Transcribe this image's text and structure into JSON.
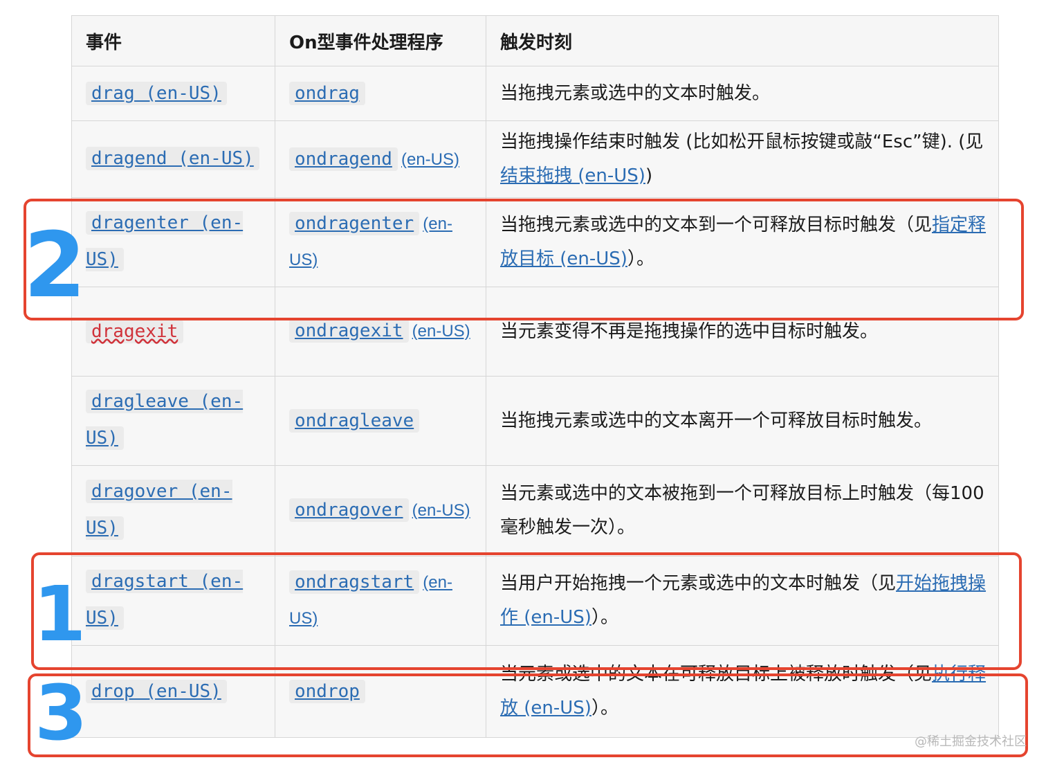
{
  "headers": {
    "event": "事件",
    "handler": "On型事件处理程序",
    "time": "触发时刻"
  },
  "rows": [
    {
      "event": "drag (en-US)",
      "handler": "ondrag",
      "handler_note": "",
      "desc": "当拖拽元素或选中的文本时触发。",
      "desc_link": "",
      "desc_suffix": ""
    },
    {
      "event": "dragend (en-US)",
      "handler": "ondragend",
      "handler_note": "(en-US)",
      "desc": "当拖拽操作结束时触发 (比如松开鼠标按键或敲“Esc”键). (见",
      "desc_link": "结束拖拽 (en-US)",
      "desc_suffix": ")"
    },
    {
      "event": "dragenter (en-US)",
      "handler": "ondragenter",
      "handler_note": "(en-US)",
      "desc": "当拖拽元素或选中的文本到一个可释放目标时触发（见",
      "desc_link": "指定释放目标 (en-US)",
      "desc_suffix": "）。"
    },
    {
      "event": "dragexit",
      "handler": "ondragexit",
      "handler_note": "(en-US)",
      "desc": "当元素变得不再是拖拽操作的选中目标时触发。",
      "desc_link": "",
      "desc_suffix": ""
    },
    {
      "event": "dragleave (en-US)",
      "handler": "ondragleave",
      "handler_note": "",
      "desc": "当拖拽元素或选中的文本离开一个可释放目标时触发。",
      "desc_link": "",
      "desc_suffix": ""
    },
    {
      "event": "dragover (en-US)",
      "handler": "ondragover",
      "handler_note": "(en-US)",
      "desc": "当元素或选中的文本被拖到一个可释放目标上时触发（每100毫秒触发一次）。",
      "desc_link": "",
      "desc_suffix": ""
    },
    {
      "event": "dragstart (en-US)",
      "handler": "ondragstart",
      "handler_note": "(en-US)",
      "desc": "当用户开始拖拽一个元素或选中的文本时触发（见",
      "desc_link": "开始拖拽操作 (en-US)",
      "desc_suffix": "）。"
    },
    {
      "event": "drop (en-US)",
      "handler": "ondrop",
      "handler_note": "",
      "desc": "当元素或选中的文本在可释放目标上被释放时触发（见",
      "desc_link": "执行释放 (en-US)",
      "desc_suffix": "）。"
    }
  ],
  "annotations": {
    "first": "1",
    "second": "2",
    "third": "3"
  },
  "watermark": "@稀土掘金技术社区",
  "colors": {
    "link": "#2b6cb3",
    "annotation_box": "#e5442f",
    "annotation_number": "#2f97ee"
  }
}
